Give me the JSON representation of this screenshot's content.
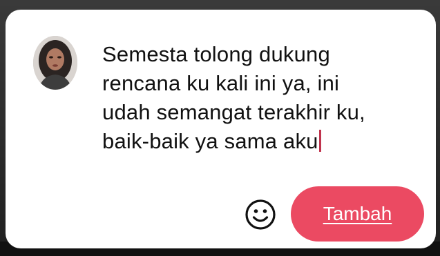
{
  "comment_box": {
    "text": "Semesta tolong dukung rencana ku kali ini ya, ini udah semangat terakhir ku, baik-baik ya sama aku",
    "lines": [
      "Semesta tolong dukung",
      "rencana ku kali ini ya, ini",
      "udah semangat terakhir ku,",
      "baik-baik ya sama aku"
    ],
    "caret_color": "#c0334d"
  },
  "avatar": {
    "icon": "user-avatar"
  },
  "actions": {
    "emoji_icon": "smiley-icon",
    "submit_label": "Tambah",
    "submit_color": "#eb4a62"
  }
}
